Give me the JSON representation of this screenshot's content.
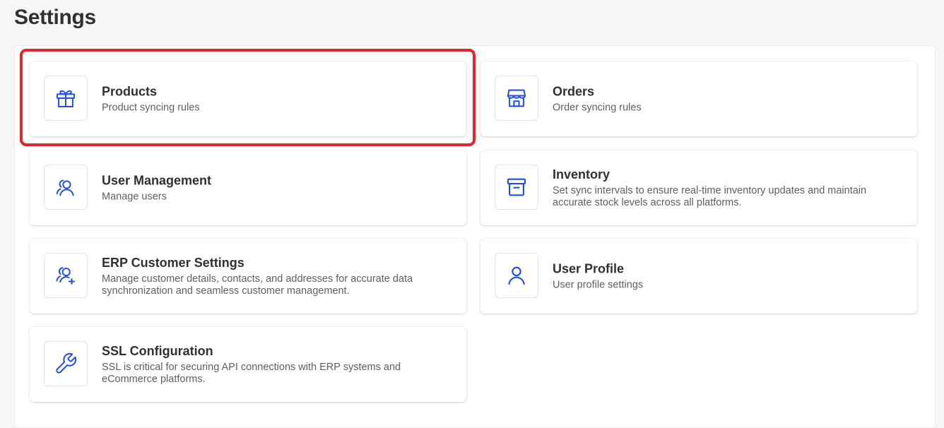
{
  "header": {
    "title": "Settings"
  },
  "cards": {
    "products": {
      "title": "Products",
      "desc": "Product syncing rules"
    },
    "orders": {
      "title": "Orders",
      "desc": "Order syncing rules"
    },
    "users": {
      "title": "User Management",
      "desc": "Manage users"
    },
    "inventory": {
      "title": "Inventory",
      "desc": "Set sync intervals to ensure real-time inventory updates and maintain accurate stock levels across all platforms."
    },
    "erp": {
      "title": "ERP Customer Settings",
      "desc": "Manage customer details, contacts, and addresses for accurate data synchronization and seamless customer management."
    },
    "profile": {
      "title": "User Profile",
      "desc": "User profile settings"
    },
    "ssl": {
      "title": "SSL Configuration",
      "desc": "SSL is critical for securing API connections with ERP systems and eCommerce platforms."
    }
  },
  "icons": {
    "products": "gift-icon",
    "orders": "store-icon",
    "users": "users-icon",
    "inventory": "archive-box-icon",
    "erp": "user-add-icon",
    "profile": "user-icon",
    "ssl": "wrench-icon"
  },
  "colors": {
    "accent": "#1f4fe0",
    "highlight": "#e3262b",
    "background": "#f6f6f7"
  }
}
